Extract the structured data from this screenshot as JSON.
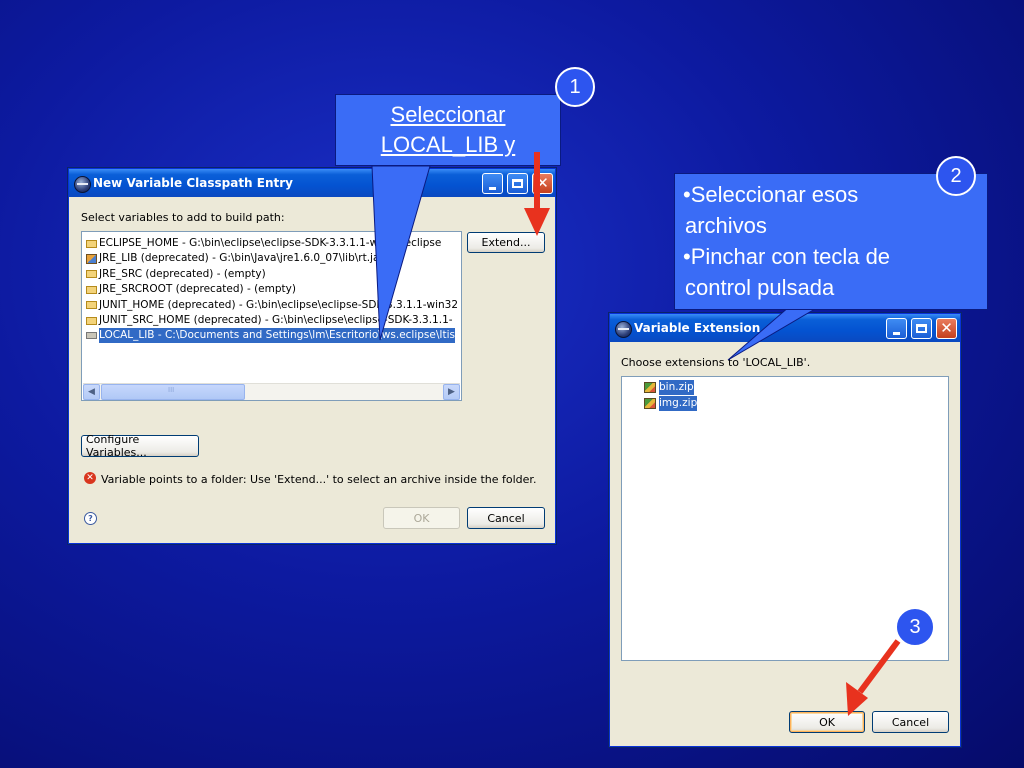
{
  "dialog1": {
    "title": "New Variable Classpath Entry",
    "prompt": "Select variables to add to build path:",
    "variables": [
      {
        "label": "ECLIPSE_HOME - G:\\bin\\eclipse\\eclipse-SDK-3.3.1.1-win32\\eclipse",
        "icon": "folder-icon"
      },
      {
        "label": "JRE_LIB (deprecated) - G:\\bin\\Java\\jre1.6.0_07\\lib\\rt.jar",
        "icon": "jar-icon"
      },
      {
        "label": "JRE_SRC (deprecated) - (empty)",
        "icon": "folder-icon"
      },
      {
        "label": "JRE_SRCROOT (deprecated) - (empty)",
        "icon": "folder-icon"
      },
      {
        "label": "JUNIT_HOME (deprecated) - G:\\bin\\eclipse\\eclipse-SDK-3.3.1.1-win32",
        "icon": "folder-icon"
      },
      {
        "label": "JUNIT_SRC_HOME (deprecated) - G:\\bin\\eclipse\\eclipse-SDK-3.3.1.1-",
        "icon": "folder-icon"
      },
      {
        "label": "LOCAL_LIB - C:\\Documents and Settings\\lm\\Escritorio\\ws.eclipse\\Itis",
        "icon": "folder-icon",
        "selected": true
      }
    ],
    "extend_label": "Extend...",
    "configure_label": "Configure Variables...",
    "error_message": "Variable points to a folder: Use 'Extend...' to select an archive inside the folder.",
    "ok_label": "OK",
    "cancel_label": "Cancel",
    "scroll_grip": "III"
  },
  "dialog2": {
    "title": "Variable Extension",
    "prompt": "Choose extensions to 'LOCAL_LIB'.",
    "files": [
      {
        "label": "bin.zip",
        "selected": true
      },
      {
        "label": "img.zip",
        "selected": true
      }
    ],
    "ok_label": "OK",
    "cancel_label": "Cancel"
  },
  "annotations": {
    "step1": {
      "number": "1",
      "text_line1": "Seleccionar",
      "text_line2": "LOCAL_LIB y"
    },
    "step2": {
      "number": "2",
      "bullet1_line1": "•Seleccionar esos",
      "bullet1_line2": "archivos",
      "bullet2_line1": "•Pinchar con tecla de",
      "bullet2_line2": "control pulsada"
    },
    "step3": {
      "number": "3"
    }
  },
  "colors": {
    "callout_fill": "#3a6cf6",
    "arrow_red": "#e8321e",
    "selection_blue": "#316ac5",
    "xp_title_blue": "#0453d1"
  }
}
